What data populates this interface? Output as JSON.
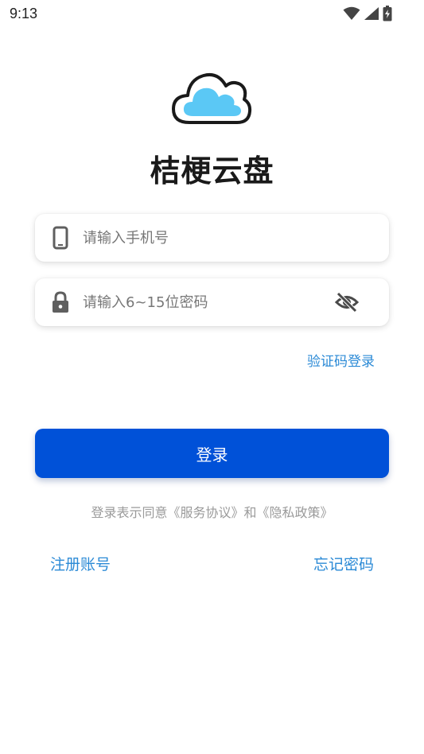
{
  "status_bar": {
    "time": "9:13",
    "icons": [
      "wifi-icon",
      "cellular-signal-icon",
      "battery-charging-icon"
    ]
  },
  "app": {
    "logo_icon": "cloud-icon",
    "title": "桔梗云盘"
  },
  "phone_field": {
    "icon": "phone-icon",
    "placeholder": "请输入手机号",
    "value": ""
  },
  "password_field": {
    "icon": "lock-icon",
    "placeholder": "请输入6~15位密码",
    "value": "",
    "toggle_icon": "eye-off-icon"
  },
  "sms_login_label": "验证码登录",
  "login_button_label": "登录",
  "agreement_text": "登录表示同意《服务协议》和《隐私政策》",
  "register_label": "注册账号",
  "forgot_password_label": "忘记密码",
  "colors": {
    "primary_button": "#0051d8",
    "link": "#2b8ad6",
    "cloud_fill": "#5bc8f5",
    "muted_text": "#9a9a9a"
  }
}
